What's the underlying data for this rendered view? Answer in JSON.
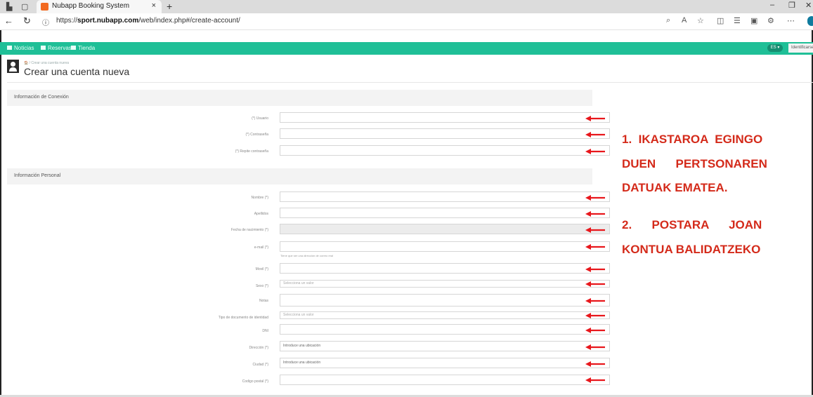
{
  "browser": {
    "tab_title": "Nubapp Booking System",
    "tab_close": "×",
    "new_tab": "+",
    "url_prefix": "https://",
    "url_host": "sport.nubapp.com",
    "url_path": "/web/index.php#/create-account/",
    "minimize": "–",
    "restore": "❐",
    "close": "✕"
  },
  "site_nav": {
    "items": [
      "Noticias",
      "Reservas",
      "Tienda"
    ],
    "lang": "ES ▾",
    "login": "Identificarse"
  },
  "page": {
    "breadcrumb": "🏠 / Crear una cuenta nueva",
    "title": "Crear una cuenta nueva"
  },
  "sections": {
    "connection": "Información de Conexión",
    "personal": "Información Personal"
  },
  "fields": {
    "usuario": "(*) Usuario",
    "contrasena": "(*) Contraseña",
    "repite": "(*) Repite contraseña",
    "nombre": "Nombre (*)",
    "apellidos": "Apellidos",
    "fecha": "Fecha de nacimiento (*)",
    "email": "e-mail (*)",
    "email_help": "Tiene que ser una dirección de correo real",
    "movil": "Movil (*)",
    "sexo": "Sexo (*)",
    "sexo_ph": "Selecciona un valor",
    "notas": "Notas",
    "tipo_doc": "Tipo de documento de identidad",
    "tipo_doc_ph": "Selecciona un valor",
    "dni": "DNI",
    "direccion": "Dirección (*)",
    "direccion_val": "Introduce una ubicación",
    "ciudad": "Ciudad (*)",
    "ciudad_val": "Introduce una ubicación",
    "codigo_postal": "Codigo postal (*)"
  },
  "annotation": {
    "note1_line1": "1.  IKASTAROA  EGINGO",
    "note1_line2": "DUEN      PERTSONAREN",
    "note1_line3": "DATUAK EMATEA.",
    "note2_line1": "2.      POSTARA      JOAN",
    "note2_line2": "KONTUA BALIDATZEKO",
    "arrow_color": "#e8171c"
  }
}
